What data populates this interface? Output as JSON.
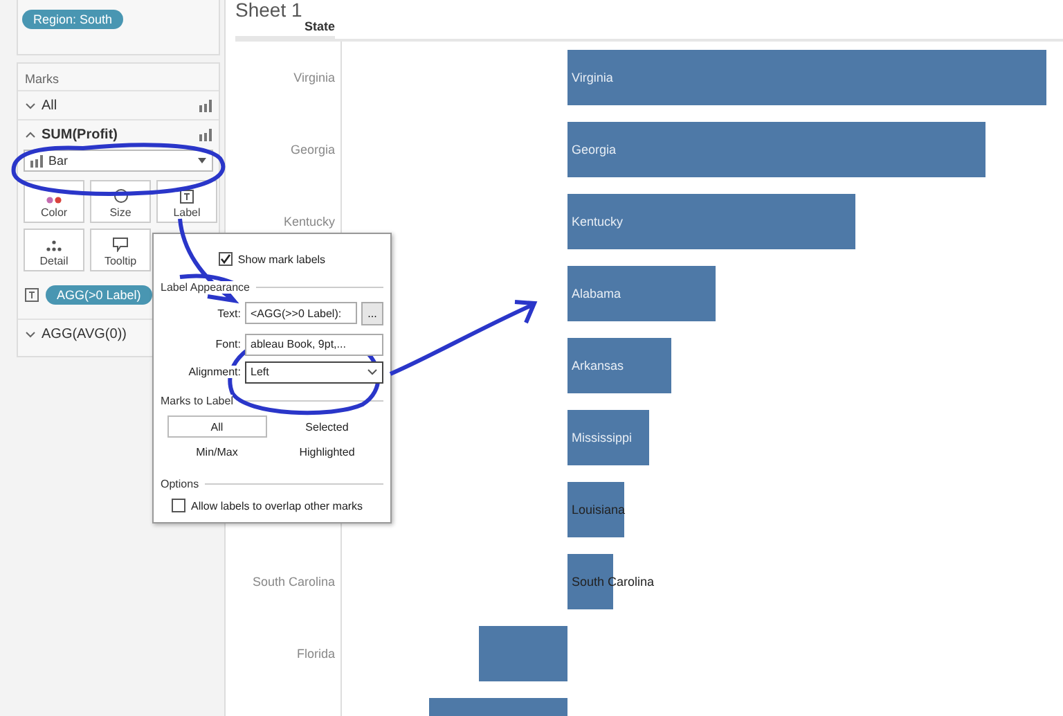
{
  "filter_pill": "Region: South",
  "marks": {
    "title": "Marks",
    "cards": [
      {
        "label": "All",
        "expanded": false
      },
      {
        "label": "SUM(Profit)",
        "expanded": true
      }
    ],
    "mark_type": "Bar",
    "buttons": [
      {
        "label": "Color",
        "kind": "color"
      },
      {
        "label": "Size",
        "kind": "size"
      },
      {
        "label": "Label",
        "kind": "label"
      },
      {
        "label": "Detail",
        "kind": "detail"
      },
      {
        "label": "Tooltip",
        "kind": "tooltip"
      }
    ],
    "label_pill": "AGG(>0 Label)",
    "other_card": {
      "label": "AGG(AVG(0))",
      "expanded": false
    }
  },
  "sheet": {
    "title": "Sheet 1",
    "header": "State",
    "rows": [
      {
        "state": "Virginia",
        "bar_label": "Virginia",
        "label_inside": true
      },
      {
        "state": "Georgia",
        "bar_label": "Georgia",
        "label_inside": true
      },
      {
        "state": "Kentucky",
        "bar_label": "Kentucky",
        "label_inside": true
      },
      {
        "bar_label": "Alabama",
        "label_inside": true
      },
      {
        "bar_label": "Arkansas",
        "label_inside": true
      },
      {
        "bar_label": "Mississippi",
        "label_inside": true
      },
      {
        "bar_label": "Louisiana",
        "label_inside": false
      },
      {
        "state": "South Carolina",
        "bar_label": "South Carolina",
        "label_inside": false
      },
      {
        "state": "Florida"
      },
      {}
    ]
  },
  "label_popup": {
    "show_labels": {
      "label": "Show mark labels",
      "checked": true
    },
    "appearance_title": "Label Appearance",
    "text_label": "Text:",
    "text_value": "<AGG(>>0 Label):",
    "more_button": "...",
    "font_label": "Font:",
    "font_value": "ableau Book, 9pt,...",
    "alignment_label": "Alignment:",
    "alignment_value": "Left",
    "marks_title": "Marks to Label",
    "marks_options": [
      {
        "label": "All",
        "selected": true
      },
      {
        "label": "Selected",
        "selected": false
      },
      {
        "label": "Min/Max",
        "selected": false
      },
      {
        "label": "Highlighted",
        "selected": false
      }
    ],
    "options_title": "Options",
    "overlap": {
      "label": "Allow labels to overlap other marks",
      "checked": false
    }
  }
}
